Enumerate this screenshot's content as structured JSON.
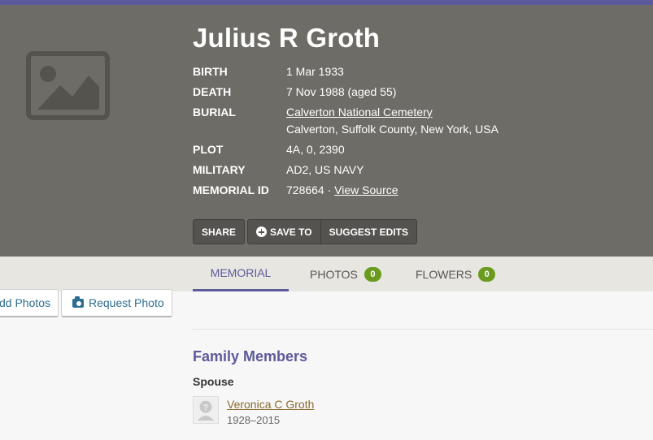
{
  "memorial": {
    "name": "Julius R Groth",
    "facts": {
      "birth_label": "BIRTH",
      "birth_value": "1 Mar 1933",
      "death_label": "DEATH",
      "death_value": "7 Nov 1988 (aged 55)",
      "burial_label": "BURIAL",
      "burial_cemetery": "Calverton National Cemetery",
      "burial_location": "Calverton, Suffolk County, New York, USA",
      "plot_label": "PLOT",
      "plot_value": "4A, 0, 2390",
      "military_label": "MILITARY",
      "military_value": "AD2, US NAVY",
      "id_label": "MEMORIAL ID",
      "id_value": "728664 ·",
      "view_source": "View Source"
    },
    "actions": {
      "share": "SHARE",
      "save_to": "SAVE TO",
      "suggest_edits": "SUGGEST EDITS"
    }
  },
  "tabs": [
    {
      "label": "MEMORIAL",
      "active": true
    },
    {
      "label": "PHOTOS",
      "count": "0"
    },
    {
      "label": "FLOWERS",
      "count": "0"
    }
  ],
  "photo_buttons": {
    "add": "dd Photos",
    "request": "Request Photo"
  },
  "family": {
    "title": "Family Members",
    "relation": "Spouse",
    "members": [
      {
        "name": "Veronica C Groth",
        "years": "1928–2015"
      }
    ]
  },
  "colors": {
    "hero_bg": "#6e6c66",
    "accent": "#5c5a9a",
    "badge": "#6a9b1f",
    "link": "#2d6e8e",
    "member_link": "#8a6b2f"
  },
  "icons": [
    "image-placeholder-icon",
    "plus-circle-icon",
    "camera-icon",
    "unknown-person-icon"
  ]
}
